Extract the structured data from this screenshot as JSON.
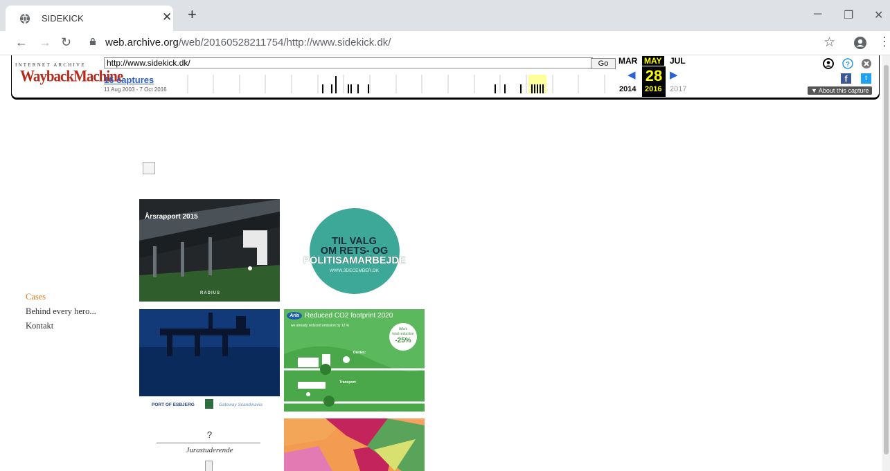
{
  "browser": {
    "tab_title": "SIDEKICK",
    "url_host": "web.archive.org",
    "url_path": "/web/20160528211754/http://www.sidekick.dk/"
  },
  "wayback": {
    "logo_top": "INTERNET ARCHIVE",
    "logo": "WaybackMachine",
    "url_value": "http://www.sidekick.dk/",
    "go_label": "Go",
    "captures_label": "16 captures",
    "date_range": "11 Aug 2003 - 7 Oct 2016",
    "prev_month": "MAR",
    "cur_month": "MAY",
    "next_month": "JUL",
    "day": "28",
    "prev_year": "2014",
    "cur_year": "2016",
    "next_year": "2017",
    "about_label": "▼ About this capture"
  },
  "nav": {
    "items": [
      "Cases",
      "Behind every hero...",
      "Kontakt"
    ]
  },
  "tiles": {
    "arsrapport_title": "Årsrapport 2015",
    "arsrapport_footer": "RADIUS",
    "valg_line1": "TIL VALG",
    "valg_line2": "OM RETS- OG",
    "valg_line3": "POLITISAMARBEJDE",
    "valg_url": "WWW.3DECEMBER.DK",
    "esbjerg_label": "PORT OF ESBJERG",
    "esbjerg_tag": "Gateway Scandinavia",
    "arla_brand": "Arla",
    "arla_title": "Reduced CO2 footprint 2020",
    "arla_sub": "we already reduced emission by 12 %",
    "arla_badge1": "Arla's",
    "arla_badge2": "total reduction",
    "arla_badge_pct": "-25%",
    "arla_dairies": "Dairies:",
    "arla_transport": "Transport:",
    "jura_q": "?",
    "jura_label": "Jurastuderende"
  }
}
